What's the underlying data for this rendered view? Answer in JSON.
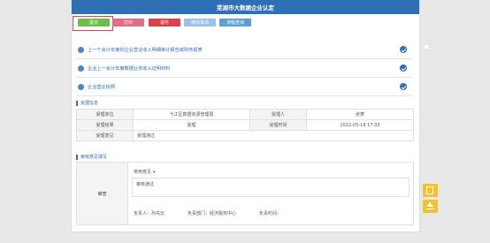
{
  "header": {
    "title": "芜湖市大数据企业认定"
  },
  "toolbar": {
    "submit": "提交",
    "print": "打印",
    "return": "退件",
    "todo_list": "待办事项",
    "track_query": "流程查询"
  },
  "documents": [
    {
      "label": "上一个会计年度的企业营业收入明细审计报告或财务报表"
    },
    {
      "label": "企业上一会计年度数据业务收入证明材料"
    },
    {
      "label": "企业营业执照"
    }
  ],
  "accept_section": {
    "title": "受理信息",
    "rows": [
      {
        "l1": "受理单位",
        "v1": "弋江区数据资源管理局",
        "l2": "受理人",
        "v2": "张菱"
      },
      {
        "l1": "受理结果",
        "v1": "受理",
        "l2": "受理时间",
        "v2": "2022-05-19 17:33"
      },
      {
        "l1": "受理意见",
        "v1": "受理通过",
        "l2": "",
        "v2": ""
      }
    ]
  },
  "review_section": {
    "title": "审核意见填写",
    "label": "审查",
    "common_opinion": "常用意见",
    "opinion_text": "审核通过",
    "handler_label": "负责人：孙先云",
    "dept_label": "负责部门：经济服务中心",
    "time_label": "负责时间："
  },
  "icons": {
    "edit": "edit-icon",
    "up": "arrow-up-icon"
  },
  "colors": {
    "header": "#2f6fb4",
    "submit": "#6dbd47",
    "side": "#f1c232"
  }
}
